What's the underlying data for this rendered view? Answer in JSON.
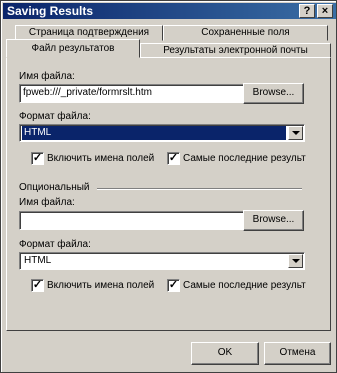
{
  "window": {
    "title": "Saving Results",
    "help_label": "?",
    "close_label": "×"
  },
  "tabs": {
    "back_left": "Страница подтверждения",
    "back_right": "Сохраненные поля",
    "front_active": "Файл результатов",
    "front_right": "Результаты электронной почты"
  },
  "results_file": {
    "file_label": "Имя файла:",
    "file_value": "fpweb:///_private/formrslt.htm",
    "browse_label": "Browse...",
    "format_label": "Формат файла:",
    "format_value": "HTML",
    "include_field_names_label": "Включить имена полей",
    "include_field_names_checked": true,
    "latest_first_label": "Самые последние результ",
    "latest_first_checked": true
  },
  "optional": {
    "section_label": "Опциональный",
    "file_label": "Имя файла:",
    "file_value": "",
    "browse_label": "Browse...",
    "format_label": "Формат файла:",
    "format_value": "HTML",
    "include_field_names_label": "Включить имена полей",
    "include_field_names_checked": true,
    "latest_first_label": "Самые последние результ",
    "latest_first_checked": true
  },
  "footer": {
    "ok_label": "OK",
    "cancel_label": "Отмена"
  },
  "colors": {
    "face": "#d4d0c8",
    "title_start": "#0a246a",
    "title_end": "#3a6ea5",
    "selection": "#0a246a"
  }
}
